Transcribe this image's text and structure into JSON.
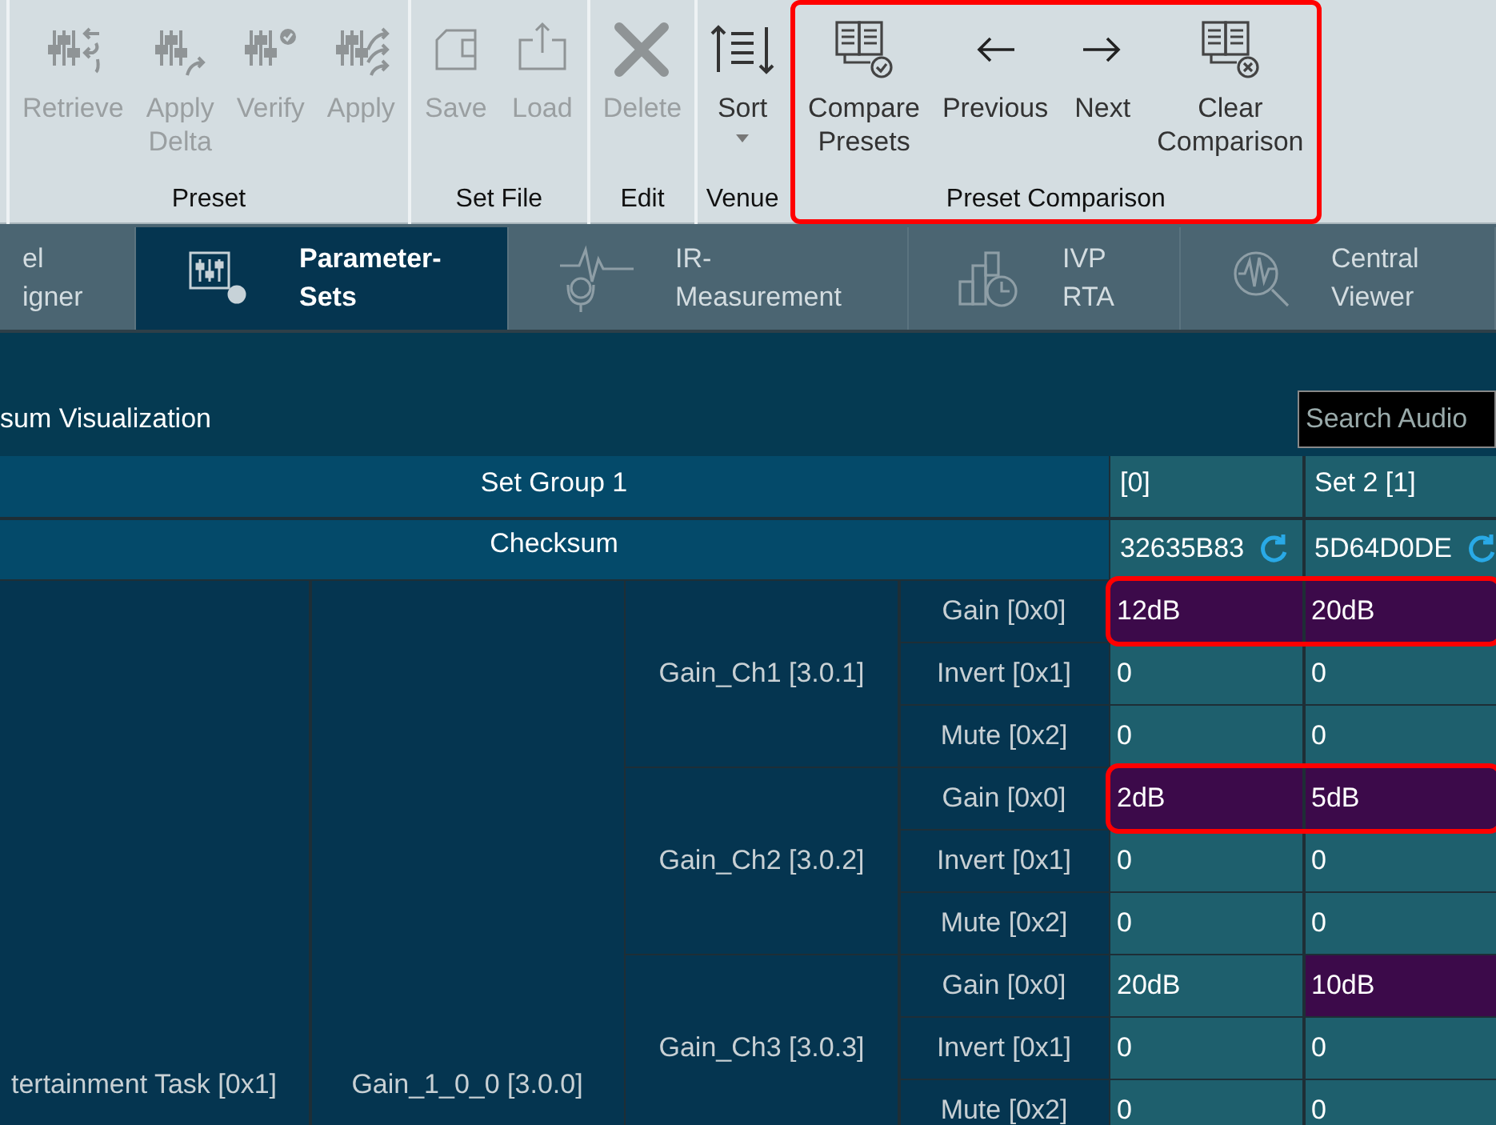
{
  "ribbon": {
    "groups": [
      {
        "label": "Preset",
        "highlighted": false,
        "buttons": [
          {
            "label": "Retrieve",
            "kind": "retrieve",
            "disabled": true
          },
          {
            "label": "Apply Delta",
            "kind": "apply-delta",
            "disabled": true
          },
          {
            "label": "Verify",
            "kind": "verify",
            "disabled": true
          },
          {
            "label": "Apply",
            "kind": "apply",
            "disabled": true
          }
        ]
      },
      {
        "label": "Set File",
        "highlighted": false,
        "buttons": [
          {
            "label": "Save",
            "kind": "save",
            "disabled": true
          },
          {
            "label": "Load",
            "kind": "load",
            "disabled": true
          }
        ]
      },
      {
        "label": "Edit",
        "highlighted": false,
        "buttons": [
          {
            "label": "Delete",
            "kind": "delete",
            "disabled": true
          }
        ]
      },
      {
        "label": "Venue",
        "highlighted": false,
        "buttons": [
          {
            "label": "Sort",
            "kind": "sort",
            "disabled": false,
            "dropdown": true
          }
        ]
      },
      {
        "label": "Preset Comparison",
        "highlighted": true,
        "buttons": [
          {
            "label": "Compare Presets",
            "kind": "compare",
            "disabled": false
          },
          {
            "label": "Previous",
            "kind": "previous",
            "disabled": false
          },
          {
            "label": "Next",
            "kind": "next",
            "disabled": false
          },
          {
            "label": "Clear Comparison",
            "kind": "clear",
            "disabled": false
          }
        ]
      }
    ]
  },
  "tabs": [
    {
      "label": "el\nigner",
      "kind": "none",
      "selected": false
    },
    {
      "label": "Parameter-\nSets",
      "kind": "params",
      "selected": true
    },
    {
      "label": "IR-\nMeasurement",
      "kind": "ir",
      "selected": false
    },
    {
      "label": "IVP\nRTA",
      "kind": "ivp",
      "selected": false
    },
    {
      "label": "Central\nViewer",
      "kind": "viewer",
      "selected": false
    }
  ],
  "panel": {
    "title": "sum Visualization",
    "search": {
      "placeholder": "Search Audio"
    }
  },
  "table": {
    "group_header": "Set Group 1",
    "checksum_header": "Checksum",
    "sets": [
      {
        "name": "[0]",
        "checksum": "32635B83"
      },
      {
        "name": "Set 2 [1]",
        "checksum": "5D64D0DE"
      }
    ],
    "task": "tertainment Task [0x1]",
    "block": "Gain_1_0_0 [3.0.0]",
    "channels": [
      {
        "name": "Gain_Ch1 [3.0.1]",
        "params": [
          {
            "name": "Gain [0x0]",
            "highlighted": true,
            "values": [
              {
                "text": "12dB",
                "differs": true
              },
              {
                "text": "20dB",
                "differs": true
              }
            ]
          },
          {
            "name": "Invert [0x1]",
            "highlighted": false,
            "values": [
              {
                "text": "0",
                "differs": false
              },
              {
                "text": "0",
                "differs": false
              }
            ]
          },
          {
            "name": "Mute [0x2]",
            "highlighted": false,
            "values": [
              {
                "text": "0",
                "differs": false
              },
              {
                "text": "0",
                "differs": false
              }
            ]
          }
        ]
      },
      {
        "name": "Gain_Ch2 [3.0.2]",
        "params": [
          {
            "name": "Gain [0x0]",
            "highlighted": true,
            "values": [
              {
                "text": "2dB",
                "differs": true
              },
              {
                "text": "5dB",
                "differs": true
              }
            ]
          },
          {
            "name": "Invert [0x1]",
            "highlighted": false,
            "values": [
              {
                "text": "0",
                "differs": false
              },
              {
                "text": "0",
                "differs": false
              }
            ]
          },
          {
            "name": "Mute [0x2]",
            "highlighted": false,
            "values": [
              {
                "text": "0",
                "differs": false
              },
              {
                "text": "0",
                "differs": false
              }
            ]
          }
        ]
      },
      {
        "name": "Gain_Ch3 [3.0.3]",
        "params": [
          {
            "name": "Gain [0x0]",
            "highlighted": false,
            "values": [
              {
                "text": "20dB",
                "differs": false
              },
              {
                "text": "10dB",
                "differs": true
              }
            ]
          },
          {
            "name": "Invert [0x1]",
            "highlighted": false,
            "values": [
              {
                "text": "0",
                "differs": false
              },
              {
                "text": "0",
                "differs": false
              }
            ]
          },
          {
            "name": "Mute [0x2]",
            "highlighted": false,
            "values": [
              {
                "text": "0",
                "differs": false
              },
              {
                "text": "0",
                "differs": false
              }
            ]
          }
        ]
      }
    ]
  }
}
